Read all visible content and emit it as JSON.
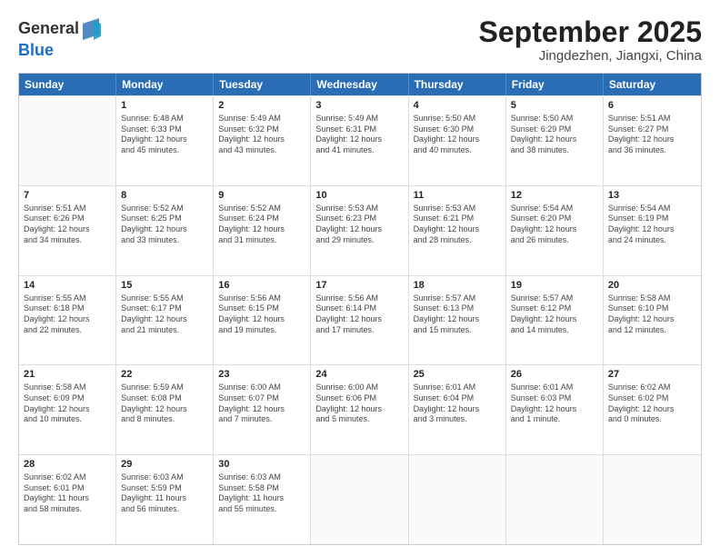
{
  "header": {
    "logo_general": "General",
    "logo_blue": "Blue",
    "title": "September 2025",
    "location": "Jingdezhen, Jiangxi, China"
  },
  "weekdays": [
    "Sunday",
    "Monday",
    "Tuesday",
    "Wednesday",
    "Thursday",
    "Friday",
    "Saturday"
  ],
  "rows": [
    [
      {
        "day": "",
        "info": ""
      },
      {
        "day": "1",
        "info": "Sunrise: 5:48 AM\nSunset: 6:33 PM\nDaylight: 12 hours\nand 45 minutes."
      },
      {
        "day": "2",
        "info": "Sunrise: 5:49 AM\nSunset: 6:32 PM\nDaylight: 12 hours\nand 43 minutes."
      },
      {
        "day": "3",
        "info": "Sunrise: 5:49 AM\nSunset: 6:31 PM\nDaylight: 12 hours\nand 41 minutes."
      },
      {
        "day": "4",
        "info": "Sunrise: 5:50 AM\nSunset: 6:30 PM\nDaylight: 12 hours\nand 40 minutes."
      },
      {
        "day": "5",
        "info": "Sunrise: 5:50 AM\nSunset: 6:29 PM\nDaylight: 12 hours\nand 38 minutes."
      },
      {
        "day": "6",
        "info": "Sunrise: 5:51 AM\nSunset: 6:27 PM\nDaylight: 12 hours\nand 36 minutes."
      }
    ],
    [
      {
        "day": "7",
        "info": "Sunrise: 5:51 AM\nSunset: 6:26 PM\nDaylight: 12 hours\nand 34 minutes."
      },
      {
        "day": "8",
        "info": "Sunrise: 5:52 AM\nSunset: 6:25 PM\nDaylight: 12 hours\nand 33 minutes."
      },
      {
        "day": "9",
        "info": "Sunrise: 5:52 AM\nSunset: 6:24 PM\nDaylight: 12 hours\nand 31 minutes."
      },
      {
        "day": "10",
        "info": "Sunrise: 5:53 AM\nSunset: 6:23 PM\nDaylight: 12 hours\nand 29 minutes."
      },
      {
        "day": "11",
        "info": "Sunrise: 5:53 AM\nSunset: 6:21 PM\nDaylight: 12 hours\nand 28 minutes."
      },
      {
        "day": "12",
        "info": "Sunrise: 5:54 AM\nSunset: 6:20 PM\nDaylight: 12 hours\nand 26 minutes."
      },
      {
        "day": "13",
        "info": "Sunrise: 5:54 AM\nSunset: 6:19 PM\nDaylight: 12 hours\nand 24 minutes."
      }
    ],
    [
      {
        "day": "14",
        "info": "Sunrise: 5:55 AM\nSunset: 6:18 PM\nDaylight: 12 hours\nand 22 minutes."
      },
      {
        "day": "15",
        "info": "Sunrise: 5:55 AM\nSunset: 6:17 PM\nDaylight: 12 hours\nand 21 minutes."
      },
      {
        "day": "16",
        "info": "Sunrise: 5:56 AM\nSunset: 6:15 PM\nDaylight: 12 hours\nand 19 minutes."
      },
      {
        "day": "17",
        "info": "Sunrise: 5:56 AM\nSunset: 6:14 PM\nDaylight: 12 hours\nand 17 minutes."
      },
      {
        "day": "18",
        "info": "Sunrise: 5:57 AM\nSunset: 6:13 PM\nDaylight: 12 hours\nand 15 minutes."
      },
      {
        "day": "19",
        "info": "Sunrise: 5:57 AM\nSunset: 6:12 PM\nDaylight: 12 hours\nand 14 minutes."
      },
      {
        "day": "20",
        "info": "Sunrise: 5:58 AM\nSunset: 6:10 PM\nDaylight: 12 hours\nand 12 minutes."
      }
    ],
    [
      {
        "day": "21",
        "info": "Sunrise: 5:58 AM\nSunset: 6:09 PM\nDaylight: 12 hours\nand 10 minutes."
      },
      {
        "day": "22",
        "info": "Sunrise: 5:59 AM\nSunset: 6:08 PM\nDaylight: 12 hours\nand 8 minutes."
      },
      {
        "day": "23",
        "info": "Sunrise: 6:00 AM\nSunset: 6:07 PM\nDaylight: 12 hours\nand 7 minutes."
      },
      {
        "day": "24",
        "info": "Sunrise: 6:00 AM\nSunset: 6:06 PM\nDaylight: 12 hours\nand 5 minutes."
      },
      {
        "day": "25",
        "info": "Sunrise: 6:01 AM\nSunset: 6:04 PM\nDaylight: 12 hours\nand 3 minutes."
      },
      {
        "day": "26",
        "info": "Sunrise: 6:01 AM\nSunset: 6:03 PM\nDaylight: 12 hours\nand 1 minute."
      },
      {
        "day": "27",
        "info": "Sunrise: 6:02 AM\nSunset: 6:02 PM\nDaylight: 12 hours\nand 0 minutes."
      }
    ],
    [
      {
        "day": "28",
        "info": "Sunrise: 6:02 AM\nSunset: 6:01 PM\nDaylight: 11 hours\nand 58 minutes."
      },
      {
        "day": "29",
        "info": "Sunrise: 6:03 AM\nSunset: 5:59 PM\nDaylight: 11 hours\nand 56 minutes."
      },
      {
        "day": "30",
        "info": "Sunrise: 6:03 AM\nSunset: 5:58 PM\nDaylight: 11 hours\nand 55 minutes."
      },
      {
        "day": "",
        "info": ""
      },
      {
        "day": "",
        "info": ""
      },
      {
        "day": "",
        "info": ""
      },
      {
        "day": "",
        "info": ""
      }
    ]
  ]
}
